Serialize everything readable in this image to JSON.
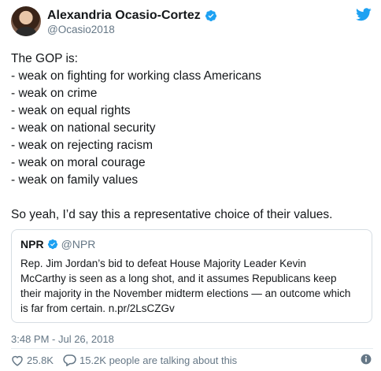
{
  "author": {
    "display_name": "Alexandria Ocasio-Cortez",
    "handle": "@Ocasio2018"
  },
  "tweet": {
    "lines": [
      "The GOP is:",
      "- weak on fighting for working class Americans",
      "- weak on crime",
      "- weak on equal rights",
      "- weak on national security",
      "- weak on rejecting racism",
      "- weak on moral courage",
      "- weak on family values"
    ],
    "closing": "So yeah, I’d say this a representative choice of their values."
  },
  "quote": {
    "name": "NPR",
    "handle": "@NPR",
    "lines": [
      "Rep. Jim Jordan’s bid to defeat House Majority Leader Kevin",
      "McCarthy is seen as a long shot, and it assumes Republicans keep",
      "their majority in the November midterm elections — an outcome which",
      "is far from certain. n.pr/2LsCZGv"
    ]
  },
  "timestamp": "3:48 PM - Jul 26, 2018",
  "actions": {
    "likes": "25.8K",
    "replies_text": "15.2K people are talking about this"
  },
  "colors": {
    "verified_blue": "#1da1f2",
    "muted_gray": "#657786"
  },
  "icons": [
    "verified-badge-icon",
    "twitter-bird-icon",
    "heart-icon",
    "reply-bubble-icon",
    "info-icon"
  ]
}
